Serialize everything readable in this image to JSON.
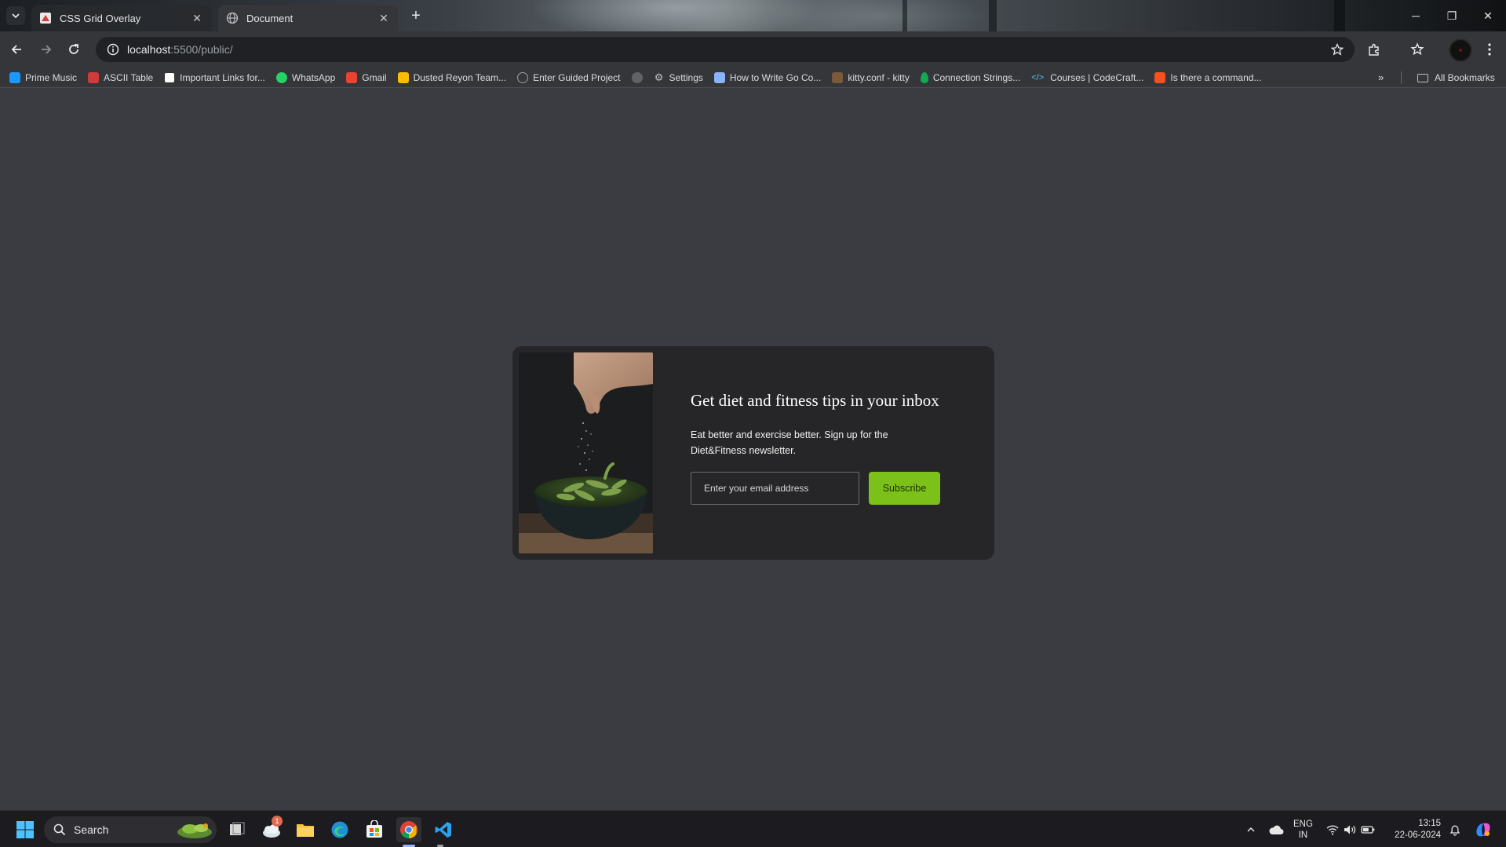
{
  "browser": {
    "tabs": [
      {
        "title": "CSS Grid Overlay",
        "active": false
      },
      {
        "title": "Document",
        "active": true
      }
    ],
    "address": {
      "host": "localhost",
      "rest": ":5500/public/"
    },
    "bookmarks": [
      {
        "label": "Prime Music",
        "color": "#1a98ff"
      },
      {
        "label": "ASCII Table",
        "color": "#d33a3a"
      },
      {
        "label": "Important Links for...",
        "color": "#ffffff"
      },
      {
        "label": "WhatsApp",
        "color": "#25d366"
      },
      {
        "label": "Gmail",
        "color": "#ea4335"
      },
      {
        "label": "Dusted Reyon Team...",
        "color": "#fbbc04"
      },
      {
        "label": "Enter Guided Project",
        "color": "#9aa0a6"
      },
      {
        "label": "",
        "color": "#9aa0a6"
      },
      {
        "label": "Settings",
        "color": "#bdc1c6"
      },
      {
        "label": "How to Write Go Co...",
        "color": "#8ab4f8"
      },
      {
        "label": "kitty.conf - kitty",
        "color": "#7a5a3a"
      },
      {
        "label": "Connection Strings...",
        "color": "#13aa52"
      },
      {
        "label": "Courses | CodeCraft...",
        "color": "#4fc3f7"
      },
      {
        "label": "Is there a command...",
        "color": "#f4511e"
      }
    ],
    "more_label": "»",
    "all_bookmarks": "All Bookmarks"
  },
  "newsletter": {
    "title": "Get diet and fitness tips in your inbox",
    "description": "Eat better and exercise better. Sign up for the Diet&Fitness newsletter.",
    "email_placeholder": "Enter your email address",
    "subscribe_label": "Subscribe",
    "accent_color": "#7cc11a"
  },
  "taskbar": {
    "search_label": "Search",
    "notification_count": "1",
    "lang_line1": "ENG",
    "lang_line2": "IN",
    "time": "13:15",
    "date": "22-06-2024"
  }
}
